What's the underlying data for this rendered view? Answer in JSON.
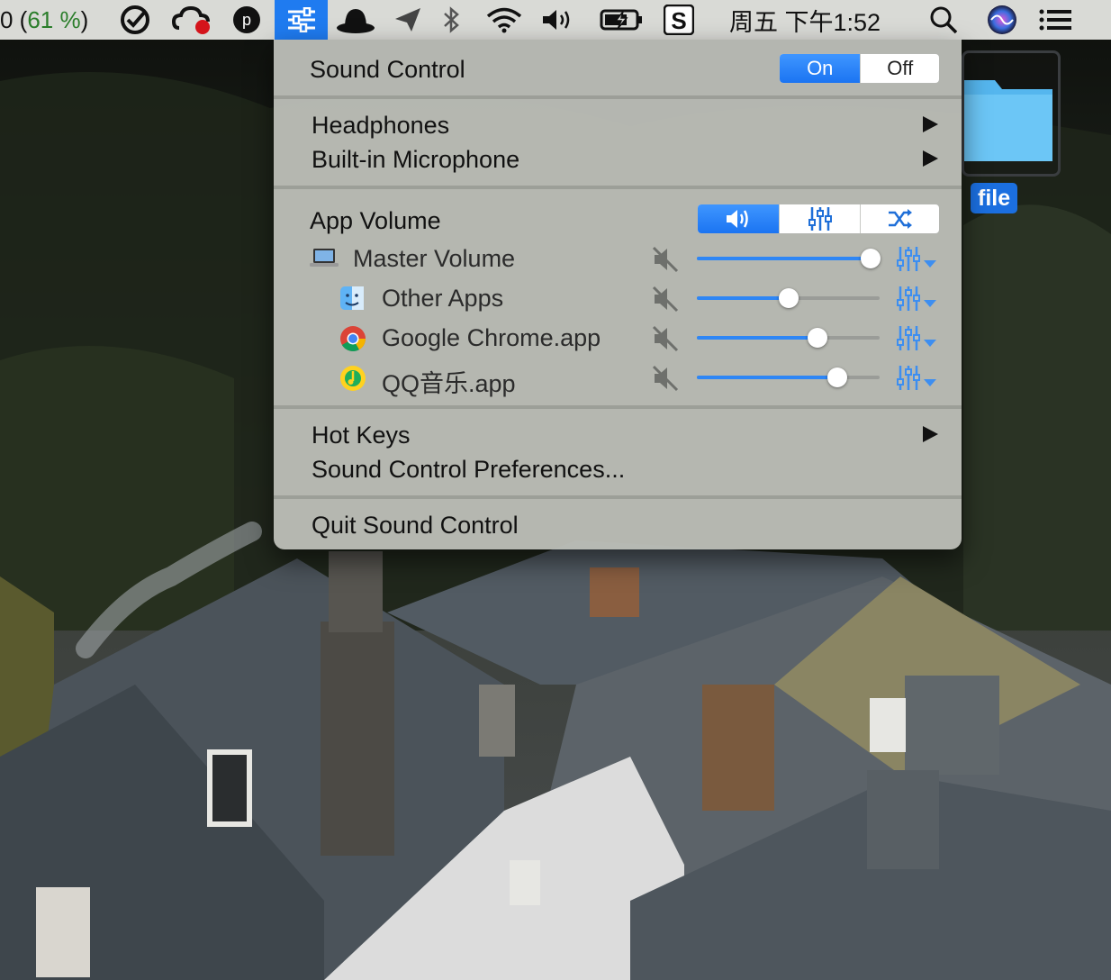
{
  "menubar": {
    "battery_prefix": "0 (",
    "battery_percent": "61 %",
    "battery_suffix": ")",
    "clock": "周五 下午1:52",
    "icons": [
      "tick-tick-icon",
      "cloud-app-icon",
      "p-app-icon",
      "sound-control-icon",
      "hat-icon",
      "send-icon",
      "bluetooth-icon",
      "wifi-icon",
      "volume-icon",
      "battery-charging-icon",
      "s-app-icon",
      "search-icon",
      "siri-icon",
      "notification-list-icon"
    ]
  },
  "desktop": {
    "folder_label": "file"
  },
  "menu": {
    "title": "Sound Control",
    "toggle": {
      "on": "On",
      "off": "Off",
      "selected": "On"
    },
    "devices": [
      {
        "label": "Headphones"
      },
      {
        "label": "Built-in Microphone"
      }
    ],
    "app_volume": {
      "label": "App Volume",
      "modes": [
        "volume-mode-icon",
        "equalizer-mode-icon",
        "shuffle-mode-icon"
      ],
      "rows": [
        {
          "label": "Master Volume",
          "icon": "macbook-icon",
          "volume": 0.95
        },
        {
          "label": "Other Apps",
          "icon": "finder-icon",
          "volume": 0.5
        },
        {
          "label": "Google Chrome.app",
          "icon": "chrome-icon",
          "volume": 0.66
        },
        {
          "label": "QQ音乐.app",
          "icon": "qq-music-icon",
          "volume": 0.77
        }
      ]
    },
    "hot_keys": "Hot Keys",
    "preferences": "Sound Control Preferences...",
    "quit": "Quit Sound Control"
  },
  "colors": {
    "accent": "#1f7bf0",
    "slider_fill": "#2e86f5",
    "battery_green": "#2a7d2a"
  }
}
